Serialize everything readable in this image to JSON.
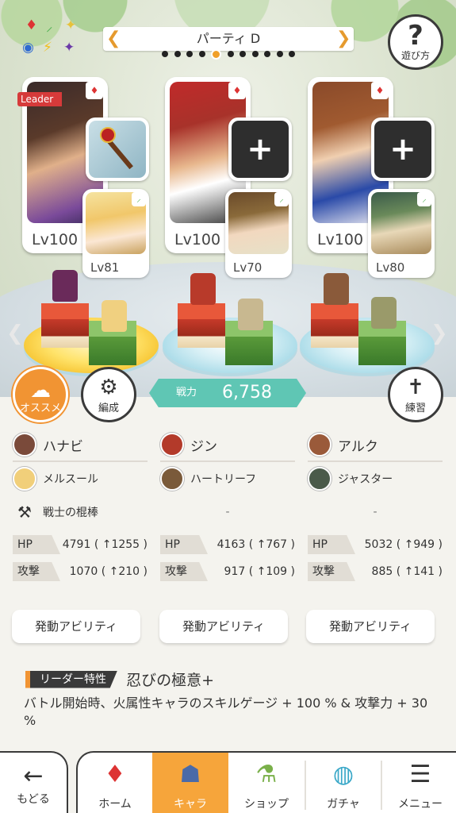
{
  "header": {
    "party_title": "パーティ D",
    "help_label": "遊び方",
    "page_dots": 11,
    "active_dot": 4
  },
  "party": {
    "leader_badge": "Leader",
    "members": [
      {
        "main_lv": "Lv100",
        "sub_lv": "Lv81",
        "weapon": "staff",
        "weapon_empty": false
      },
      {
        "main_lv": "Lv100",
        "sub_lv": "Lv70",
        "weapon": "shield",
        "weapon_empty": true
      },
      {
        "main_lv": "Lv100",
        "sub_lv": "Lv80",
        "weapon": "shield",
        "weapon_empty": true
      }
    ]
  },
  "actions": {
    "recommend_label": "オススメ",
    "formation_label": "編成",
    "power_label": "戦力",
    "power_value": "6,758",
    "practice_label": "練習"
  },
  "columns": [
    {
      "main": "ハナビ",
      "sub": "メルスール",
      "equip": "戦士の棍棒",
      "hp_label": "HP",
      "hp": "4791 ( ↑1255 )",
      "atk_label": "攻撃",
      "atk": "1070 ( ↑210 )",
      "ability": "発動アビリティ"
    },
    {
      "main": "ジン",
      "sub": "ハートリーフ",
      "equip": "-",
      "hp_label": "HP",
      "hp": "4163 ( ↑767 )",
      "atk_label": "攻撃",
      "atk": "917 ( ↑109 )",
      "ability": "発動アビリティ"
    },
    {
      "main": "アルク",
      "sub": "ジャスター",
      "equip": "-",
      "hp_label": "HP",
      "hp": "5032 ( ↑949 )",
      "atk_label": "攻撃",
      "atk": "885 ( ↑141 )",
      "ability": "発動アビリティ"
    }
  ],
  "leader_skill": {
    "tag": "リーダー特性",
    "title": "忍びの極意+",
    "description": "バトル開始時、火属性キャラのスキルゲージ + 100 % & 攻撃力 + 30 %"
  },
  "nav": {
    "back": "もどる",
    "items": [
      "ホーム",
      "キャラ",
      "ショップ",
      "ガチャ",
      "メニュー"
    ],
    "active": "キャラ"
  },
  "colors": {
    "accent_orange": "#f19433",
    "power_teal": "#5fc6b4",
    "leader_red": "#d63a3a"
  }
}
